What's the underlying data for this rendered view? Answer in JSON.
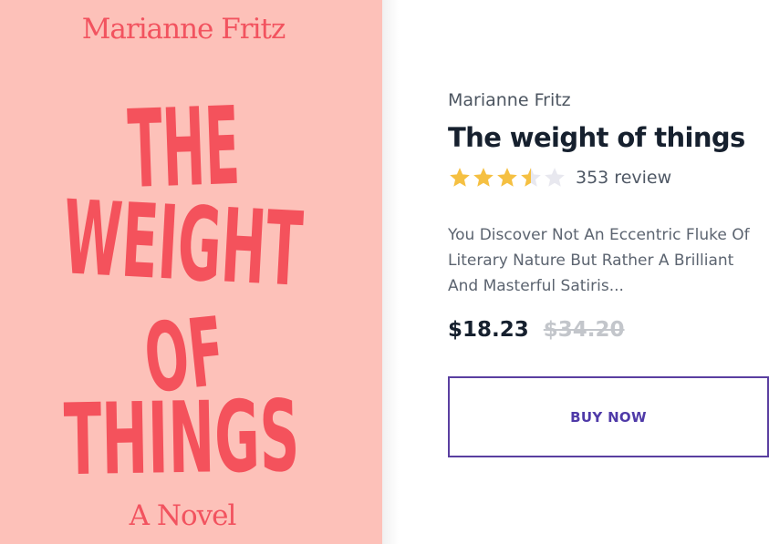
{
  "cover": {
    "author": "Marianne Fritz",
    "title_words": [
      "THE",
      "WEIGHT",
      "OF",
      "THINGS"
    ],
    "subtitle": "A Novel",
    "background_color": "#fdc1b9",
    "text_color": "#f4525c"
  },
  "product": {
    "author": "Marianne Fritz",
    "title": "The weight of things",
    "rating": {
      "value": 3.5,
      "max": 5,
      "review_count": "353 review"
    },
    "description": "You Discover Not An Eccentric Fluke Of Literary Nature But Rather A Brilliant And Masterful Satiris...",
    "price": "$18.23",
    "original_price": "$34.20",
    "buy_label": "BUY NOW"
  },
  "colors": {
    "accent": "#5a3fa0",
    "star_filled": "#f5c042",
    "star_empty": "#e8e8ef",
    "title_text": "#16202e"
  }
}
